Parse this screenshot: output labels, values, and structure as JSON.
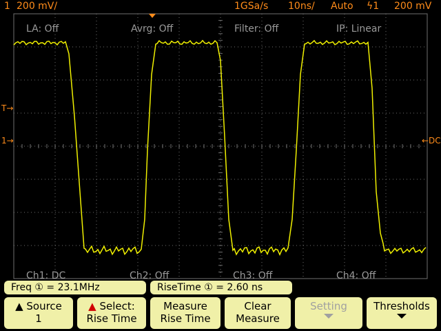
{
  "topbar": {
    "channel": "1",
    "vdiv": "200 mV/",
    "sample_rate": "1GSa/s",
    "tdiv": "10ns/",
    "trigger_mode": "Auto",
    "trigger_source": "ϟ1",
    "trigger_level": "200 mV"
  },
  "grid_labels": {
    "la": "LA: Off",
    "avrg": "Avrg: Off",
    "filter": "Filter: Off",
    "ip": "IP: Linear",
    "ch1": "Ch1: DC",
    "ch2": "Ch2: Off",
    "ch3": "Ch3: Off",
    "ch4": "Ch4: Off"
  },
  "markers": {
    "trigger_level_marker": "T→",
    "ground_marker": "1→",
    "dc_marker": "←DC"
  },
  "measurements": {
    "freq": "Freq ① = 23.1MHz",
    "rise": "RiseTime ① =  2.60 ns"
  },
  "softkeys": [
    {
      "line1": "▲ Source",
      "line2": "1"
    },
    {
      "line1": "Select:",
      "line2": "Rise Time"
    },
    {
      "line1": "Measure",
      "line2": "Rise Time"
    },
    {
      "line1": "Clear",
      "line2": "Measure"
    },
    {
      "line1": "Setting",
      "line2": ""
    },
    {
      "line1": "Thresholds",
      "line2": ""
    }
  ],
  "colors": {
    "trace": "#f0f000",
    "accent": "#ff8c1a",
    "grid": "#707070",
    "softkey_bg": "#f0f0a8"
  },
  "waveform": {
    "type": "square",
    "frequency_mhz": 23.1,
    "rise_time_ns": 2.6
  }
}
